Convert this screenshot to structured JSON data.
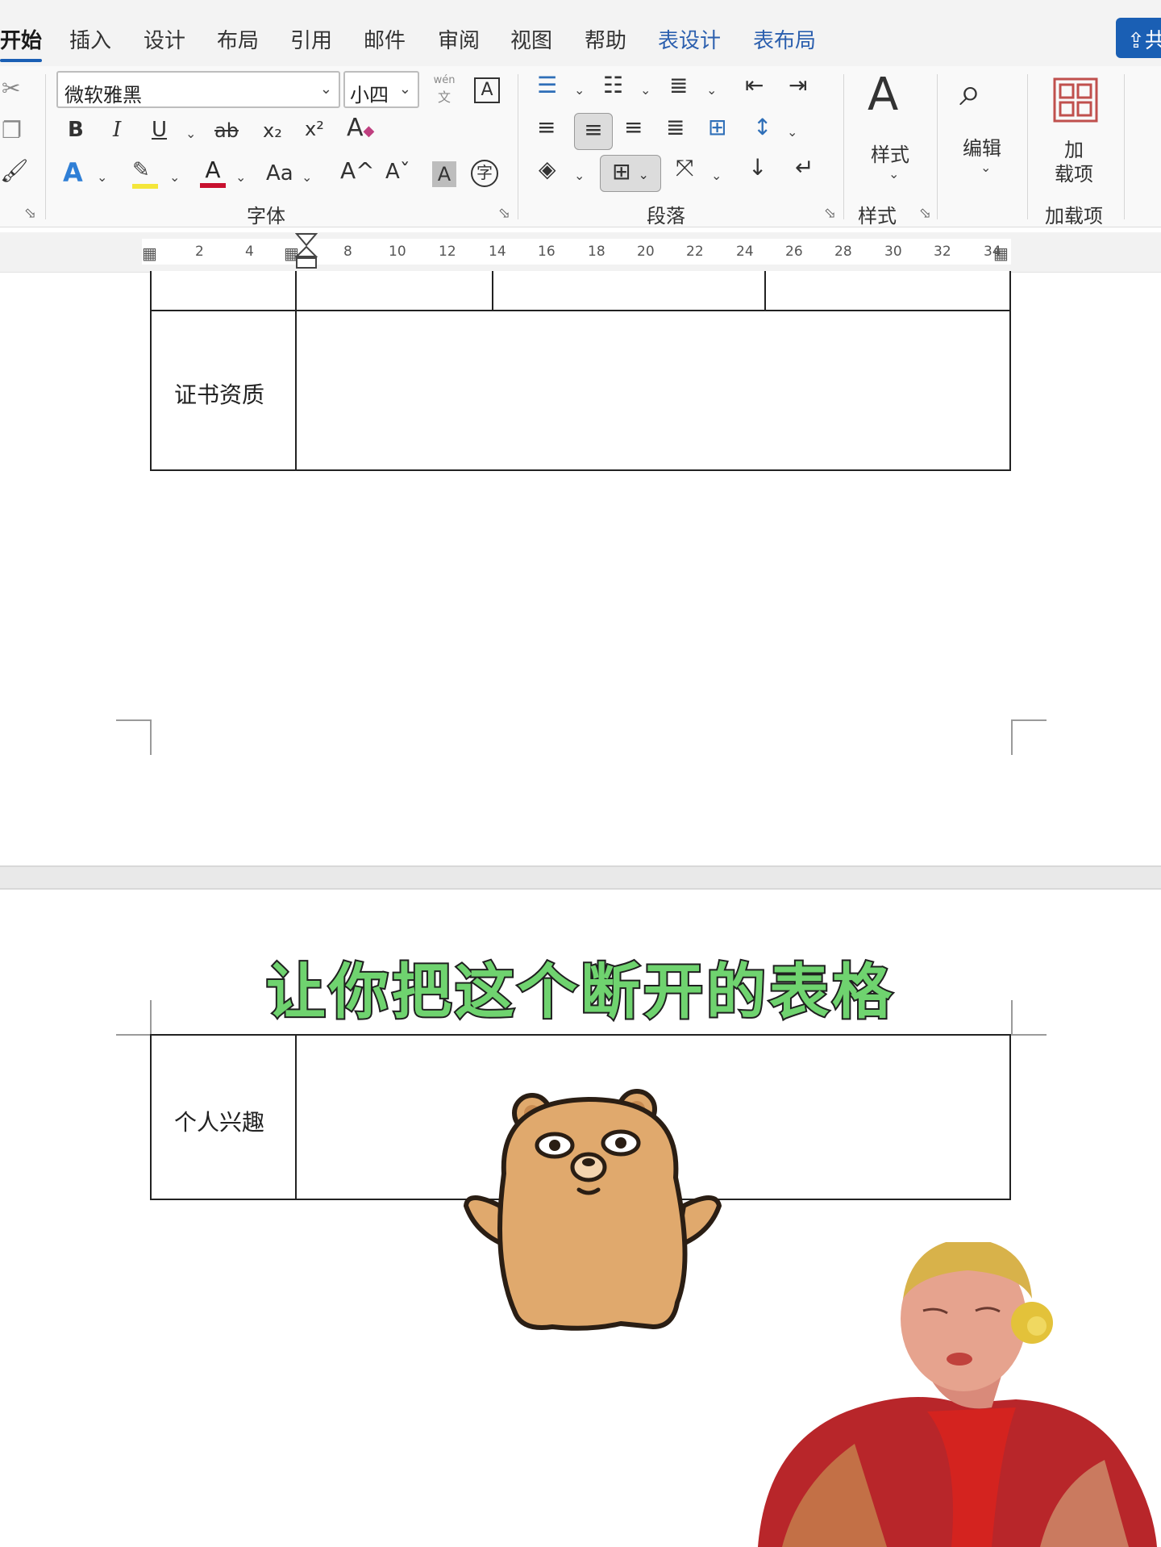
{
  "tabs": [
    {
      "label": "开始",
      "active": true
    },
    {
      "label": "插入"
    },
    {
      "label": "设计"
    },
    {
      "label": "布局"
    },
    {
      "label": "引用"
    },
    {
      "label": "邮件"
    },
    {
      "label": "审阅"
    },
    {
      "label": "视图"
    },
    {
      "label": "帮助"
    },
    {
      "label": "表设计",
      "contextual": true
    },
    {
      "label": "表布局",
      "contextual": true
    }
  ],
  "share_label": "共",
  "ribbon": {
    "font": {
      "family": "微软雅黑",
      "size": "小四",
      "pinyin_top": "wén",
      "pinyin_bottom": "文",
      "bold": "B",
      "italic": "I",
      "underline": "U",
      "strike": "ab",
      "subscript": "x₂",
      "superscript": "x²",
      "case": "Aa",
      "grow": "A^",
      "shrink": "Aˇ",
      "shade": "A",
      "enclose": "字",
      "group_label": "字体"
    },
    "paragraph": {
      "group_label": "段落"
    },
    "styles": {
      "button_label": "样式",
      "group_label": "样式"
    },
    "editing": {
      "button_label": "编辑"
    },
    "addins": {
      "button_label_1": "加",
      "button_label_2": "载项",
      "group_label": "加载项"
    }
  },
  "ruler": {
    "ticks": [
      "2",
      "4",
      "8",
      "10",
      "12",
      "14",
      "16",
      "18",
      "20",
      "22",
      "24",
      "26",
      "28",
      "30",
      "32",
      "34"
    ]
  },
  "document": {
    "row_certificate_label": "证书资质",
    "row_interest_label": "个人兴趣",
    "caption": "让你把这个断开的表格"
  },
  "colors": {
    "accent": "#1a5fb4",
    "caption_fill": "#6fd36f",
    "bear_body": "#e0a96d"
  }
}
